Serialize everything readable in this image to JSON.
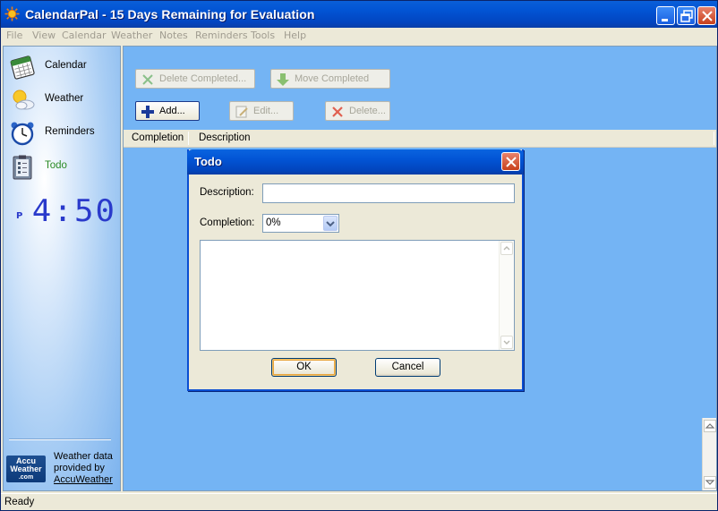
{
  "window": {
    "title": "CalendarPal - 15 Days Remaining for Evaluation",
    "icons": {
      "app": "sun-icon",
      "minimize": "minimize-icon",
      "maximize": "restore-icon",
      "close": "close-icon"
    }
  },
  "menu": [
    "File",
    "View",
    "Calendar",
    "Weather",
    "Notes",
    "Reminders",
    "Tools",
    "Help"
  ],
  "sidebar": {
    "items": [
      {
        "label": "Calendar",
        "icon": "calendar-icon"
      },
      {
        "label": "Weather",
        "icon": "weather-icon"
      },
      {
        "label": "Reminders",
        "icon": "alarm-clock-icon"
      },
      {
        "label": "Todo",
        "icon": "todo-clipboard-icon"
      }
    ],
    "clock": {
      "ampm": "P",
      "time": "4:50"
    },
    "weather_credit": {
      "logo_top": "Accu",
      "logo_mid": "Weather",
      "logo_bottom": ".com",
      "line1": "Weather data",
      "line2": "provided by",
      "link": "AccuWeather"
    }
  },
  "toolbar": {
    "delete_completed": "Delete Completed...",
    "move_completed": "Move Completed",
    "add": "Add...",
    "edit": "Edit...",
    "delete": "Delete..."
  },
  "list": {
    "columns": [
      "Completion",
      "Description"
    ]
  },
  "dialog": {
    "title": "Todo",
    "description_label": "Description:",
    "description_value": "",
    "completion_label": "Completion:",
    "completion_value": "0%",
    "ok": "OK",
    "cancel": "Cancel"
  },
  "status": "Ready",
  "colors": {
    "title_bar": "#0254d4",
    "main_panel": "#74b4f4",
    "active_nav": "#2a8a24",
    "clock": "#2a3acb"
  }
}
